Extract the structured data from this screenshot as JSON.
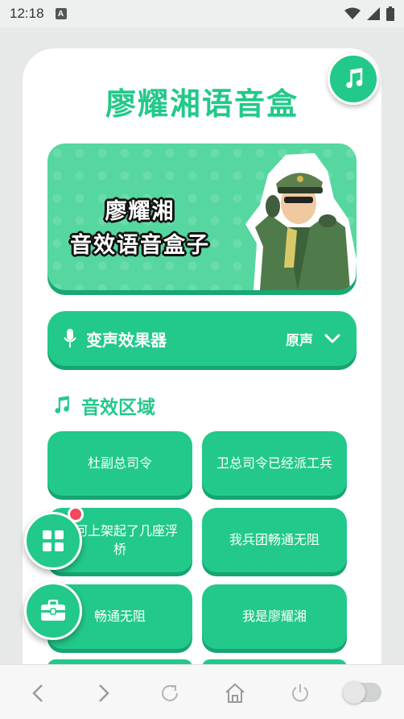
{
  "status_bar": {
    "time": "12:18",
    "notification_icon": "a-icon",
    "icons": [
      "wifi-icon",
      "signal-icon",
      "battery-icon"
    ]
  },
  "app": {
    "title": "廖耀湘语音盒",
    "music_icon": "music-note-icon"
  },
  "banner": {
    "line1": "廖耀湘",
    "line2": "音效语音盒子"
  },
  "voice_changer": {
    "icon": "microphone-icon",
    "label": "变声效果器",
    "value": "原声",
    "chevron_icon": "chevron-down-icon"
  },
  "sound_section": {
    "icon": "music-note-icon",
    "title": "音效区域",
    "buttons": [
      "杜副总司令",
      "卫总司令已经派工兵",
      "辽河上架起了几座浮桥",
      "我兵团畅通无阻",
      "畅通无阻",
      "我是廖耀湘"
    ]
  },
  "floating": {
    "apps_icon": "grid-icon",
    "toolbox_icon": "toolbox-icon",
    "badge_color": "#f04a5b"
  },
  "bottom_nav": {
    "items": [
      "back-icon",
      "forward-icon",
      "refresh-icon",
      "home-icon",
      "power-icon",
      "toggle-switch"
    ]
  },
  "colors": {
    "accent": "#22c98a",
    "accent_dark": "#16a472",
    "banner_bg": "#55d79f"
  }
}
